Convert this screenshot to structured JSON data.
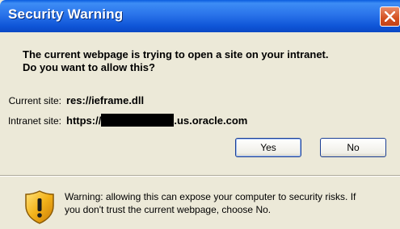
{
  "window": {
    "title": "Security Warning"
  },
  "message": {
    "question_line1": "The current webpage is trying to open a site on your intranet.",
    "question_line2": "Do you want to allow this?"
  },
  "current_site": {
    "label": "Current site:",
    "value": "res://ieframe.dll"
  },
  "intranet_site": {
    "label": "Intranet site:",
    "prefix": "https://",
    "suffix": ".us.oracle.com"
  },
  "buttons": {
    "yes": "Yes",
    "no": "No"
  },
  "warning": {
    "line1": "Warning: allowing this can expose your computer to security risks. If",
    "line2": "you don't trust the current webpage, choose No."
  },
  "icons": {
    "close": "close-icon",
    "shield": "shield-warning-icon"
  },
  "colors": {
    "titlebar": "#0a5cde",
    "close": "#d4501f",
    "dialog_bg": "#ece9d8"
  }
}
